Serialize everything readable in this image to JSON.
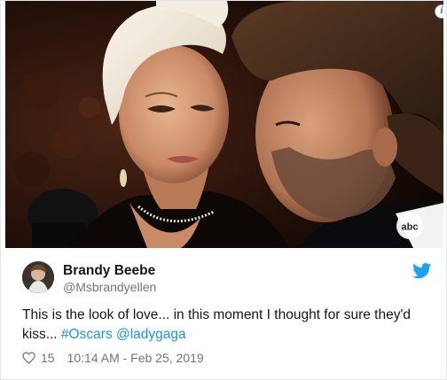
{
  "media": {
    "network_badge": "abc",
    "network_badge_icon": "abc-logo",
    "info_icon": "info-icon",
    "info_glyph": "i"
  },
  "tweet": {
    "author": {
      "display_name": "Brandy Beebe",
      "handle": "@Msbrandyellen",
      "avatar_icon": "avatar-photo"
    },
    "brand_icon": "twitter-bird-icon",
    "text_plain_1": "This is the look of love... in this moment I thought for sure they'd kiss... ",
    "hashtag": "#Oscars",
    "mention": "@ladygaga",
    "likes_count": "15",
    "likes_icon": "heart-outline-icon",
    "timestamp": "10:14 AM - Feb 25, 2019"
  },
  "colors": {
    "link": "#1b95e0",
    "text_primary": "#14171a",
    "text_secondary": "#657786",
    "twitter_blue": "#1da1f2",
    "border": "#e1e8ed"
  }
}
